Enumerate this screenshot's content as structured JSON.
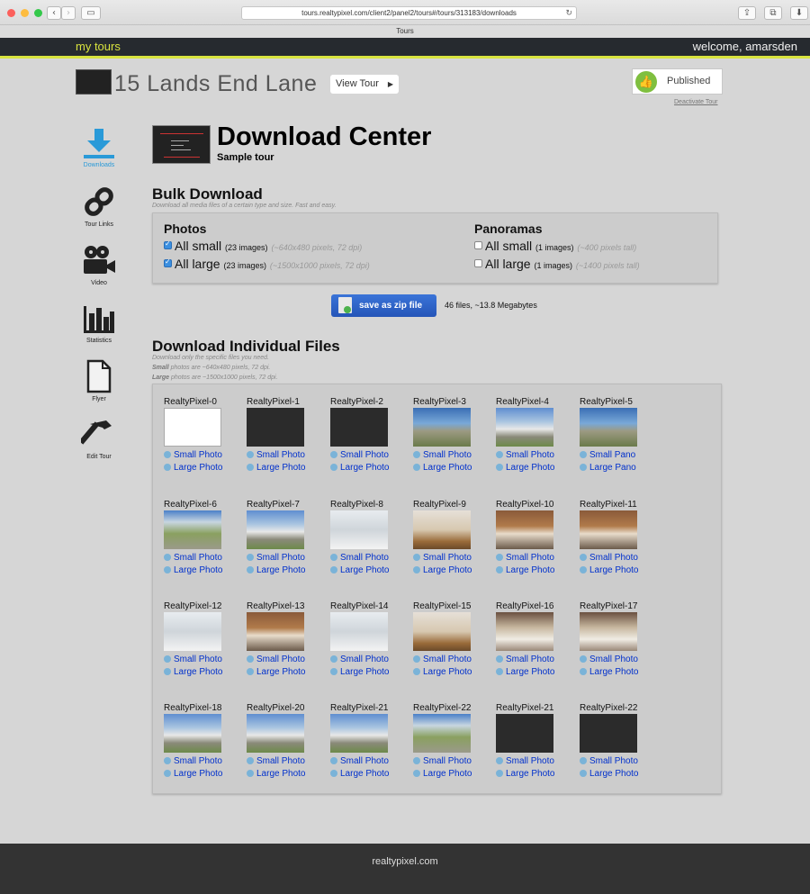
{
  "browser": {
    "url": "tours.realtypixel.com/client2/panel2/tours#/tours/313183/downloads",
    "tab_title": "Tours"
  },
  "header": {
    "my_tours": "my tours",
    "welcome": "welcome, amarsden"
  },
  "tour": {
    "title": "15 Lands End Lane",
    "view_tour": "View Tour",
    "published": "Published",
    "deactivate": "Deactivate Tour"
  },
  "sidebar": {
    "items": [
      {
        "label": "Downloads",
        "icon": "download-icon"
      },
      {
        "label": "Tour Links",
        "icon": "link-icon"
      },
      {
        "label": "Video",
        "icon": "video-camera-icon"
      },
      {
        "label": "Statistics",
        "icon": "bar-chart-icon"
      },
      {
        "label": "Flyer",
        "icon": "document-icon"
      },
      {
        "label": "Edit Tour",
        "icon": "hammer-icon"
      }
    ]
  },
  "download_center": {
    "title": "Download Center",
    "subtitle": "Sample tour"
  },
  "bulk": {
    "title": "Bulk Download",
    "note": "Download all media files of a certain type and size. Fast and easy.",
    "photos": {
      "heading": "Photos",
      "small": {
        "label": "All small",
        "count": "(23 images)",
        "pixels": "(~640x480 pixels, 72 dpi)",
        "checked": true
      },
      "large": {
        "label": "All large",
        "count": "(23 images)",
        "pixels": "(~1500x1000 pixels, 72 dpi)",
        "checked": true
      }
    },
    "panoramas": {
      "heading": "Panoramas",
      "small": {
        "label": "All small",
        "count": "(1 images)",
        "pixels": "(~400 pixels tall)",
        "checked": false
      },
      "large": {
        "label": "All large",
        "count": "(1 images)",
        "pixels": "(~1400 pixels tall)",
        "checked": false
      }
    },
    "zip_button": "save as zip file",
    "zip_info": "46 files, ~13.8 Megabytes"
  },
  "individual": {
    "title": "Download Individual Files",
    "note1": "Download only the specific files you need.",
    "note2_bold": "Small",
    "note2": "photos are ~640x480 pixels, 72 dpi.",
    "note3_bold": "Large",
    "note3": "photos are ~1500x1000 pixels, 72 dpi.",
    "files": [
      {
        "name": "RealtyPixel-0",
        "thumb": "floor",
        "link1": "Small Photo",
        "link2": "Large Photo"
      },
      {
        "name": "RealtyPixel-1",
        "thumb": "dark",
        "link1": "Small Photo",
        "link2": "Large Photo"
      },
      {
        "name": "RealtyPixel-2",
        "thumb": "dark",
        "link1": "Small Photo",
        "link2": "Large Photo"
      },
      {
        "name": "RealtyPixel-3",
        "thumb": "sky",
        "link1": "Small Photo",
        "link2": "Large Photo"
      },
      {
        "name": "RealtyPixel-4",
        "thumb": "house",
        "link1": "Small Photo",
        "link2": "Large Photo"
      },
      {
        "name": "RealtyPixel-5",
        "thumb": "sky",
        "link1": "Small Pano",
        "link2": "Large Pano"
      },
      {
        "name": "RealtyPixel-6",
        "thumb": "lot",
        "link1": "Small Photo",
        "link2": "Large Photo"
      },
      {
        "name": "RealtyPixel-7",
        "thumb": "house",
        "link1": "Small Photo",
        "link2": "Large Photo"
      },
      {
        "name": "RealtyPixel-8",
        "thumb": "white",
        "link1": "Small Photo",
        "link2": "Large Photo"
      },
      {
        "name": "RealtyPixel-9",
        "thumb": "wood",
        "link1": "Small Photo",
        "link2": "Large Photo"
      },
      {
        "name": "RealtyPixel-10",
        "thumb": "kitchen",
        "link1": "Small Photo",
        "link2": "Large Photo"
      },
      {
        "name": "RealtyPixel-11",
        "thumb": "kitchen",
        "link1": "Small Photo",
        "link2": "Large Photo"
      },
      {
        "name": "RealtyPixel-12",
        "thumb": "white",
        "link1": "Small Photo",
        "link2": "Large Photo"
      },
      {
        "name": "RealtyPixel-13",
        "thumb": "kitchen",
        "link1": "Small Photo",
        "link2": "Large Photo"
      },
      {
        "name": "RealtyPixel-14",
        "thumb": "white",
        "link1": "Small Photo",
        "link2": "Large Photo"
      },
      {
        "name": "RealtyPixel-15",
        "thumb": "wood",
        "link1": "Small Photo",
        "link2": "Large Photo"
      },
      {
        "name": "RealtyPixel-16",
        "thumb": "dining",
        "link1": "Small Photo",
        "link2": "Large Photo"
      },
      {
        "name": "RealtyPixel-17",
        "thumb": "dining",
        "link1": "Small Photo",
        "link2": "Large Photo"
      },
      {
        "name": "RealtyPixel-18",
        "thumb": "house",
        "link1": "Small Photo",
        "link2": "Large Photo"
      },
      {
        "name": "RealtyPixel-20",
        "thumb": "house",
        "link1": "Small Photo",
        "link2": "Large Photo"
      },
      {
        "name": "RealtyPixel-21",
        "thumb": "house",
        "link1": "Small Photo",
        "link2": "Large Photo"
      },
      {
        "name": "RealtyPixel-22",
        "thumb": "lot",
        "link1": "Small Photo",
        "link2": "Large Photo"
      },
      {
        "name": "RealtyPixel-21",
        "thumb": "dark",
        "link1": "Small Photo",
        "link2": "Large Photo"
      },
      {
        "name": "RealtyPixel-22",
        "thumb": "dark",
        "link1": "Small Photo",
        "link2": "Large Photo"
      }
    ]
  },
  "footer": {
    "text": "realtypixel.com"
  },
  "colors": {
    "accent": "#d8e33e",
    "active": "#2a9ad8",
    "link": "#0030cc",
    "zip_button": "#2f63c8"
  }
}
